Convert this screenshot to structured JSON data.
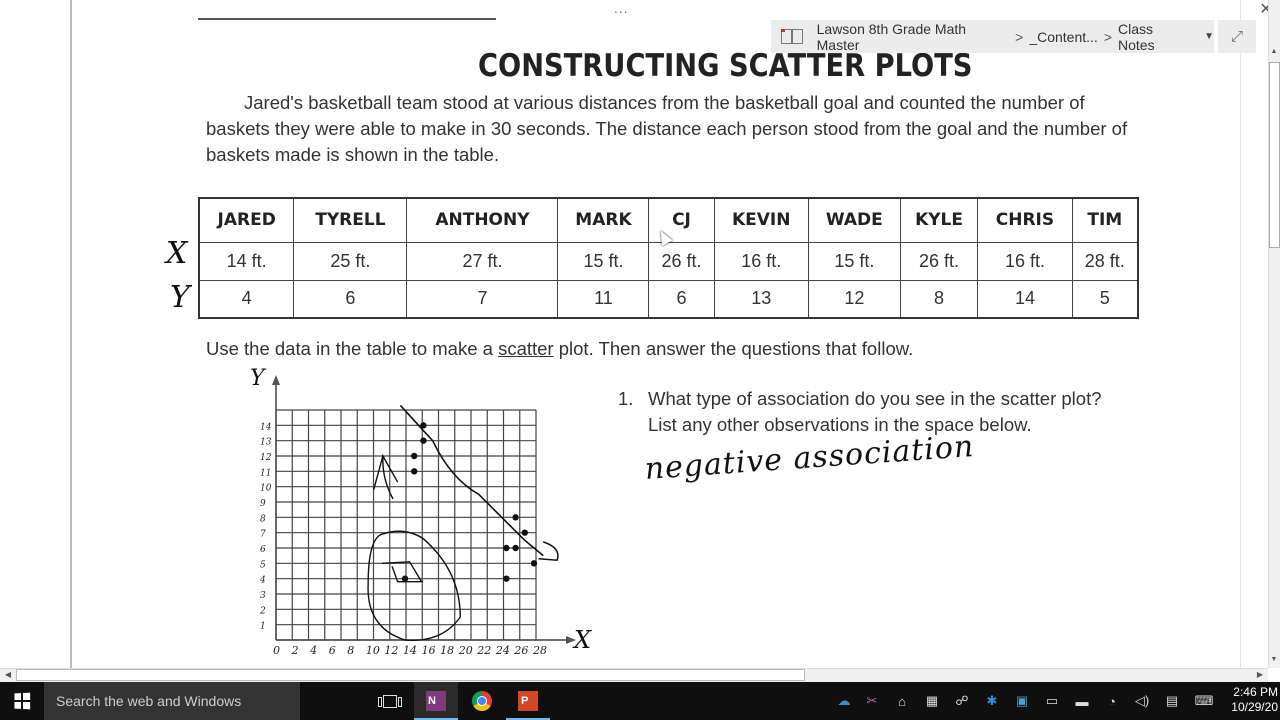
{
  "breadcrumb": {
    "notebook": "Lawson 8th Grade Math Master",
    "section": "_Content...",
    "page": "Class Notes",
    "separator": ">"
  },
  "window": {
    "more_label": "...",
    "close_glyph": "✕",
    "expand_glyph": "⤢",
    "caret_glyph": "▼"
  },
  "worksheet": {
    "title": "CONSTRUCTING SCATTER PLOTS",
    "intro": "Jared's basketball team stood at various distances from the basketball goal and counted the number of baskets they were able to make in 30 seconds. The distance each person stood from the goal and the number of baskets made is shown in the table.",
    "table": {
      "names": [
        "JARED",
        "TYRELL",
        "ANTHONY",
        "MARK",
        "CJ",
        "KEVIN",
        "WADE",
        "KYLE",
        "CHRIS",
        "TIM"
      ],
      "distances": [
        "14 ft.",
        "25 ft.",
        "27 ft.",
        "15 ft.",
        "26 ft.",
        "16 ft.",
        "15 ft.",
        "26 ft.",
        "16 ft.",
        "28 ft."
      ],
      "baskets": [
        "4",
        "6",
        "7",
        "11",
        "6",
        "13",
        "12",
        "8",
        "14",
        "5"
      ],
      "row_labels_handwritten": [
        "X",
        "Y"
      ]
    },
    "instruction_pre": "Use the data in the table to make a ",
    "instruction_ul": "scatter",
    "instruction_post": " plot. Then answer the questions that follow.",
    "question_number": "1.",
    "question_text": "What type of association do you see in the scatter plot? List any other observations in the space below.",
    "answer_handwritten": "negative association"
  },
  "chart_data": {
    "type": "scatter",
    "title": "",
    "xlabel": "X",
    "ylabel": "Y",
    "x_ticks": [
      "0",
      "2",
      "4",
      "6",
      "8",
      "10",
      "12",
      "14",
      "16",
      "18",
      "20",
      "22",
      "24",
      "26",
      "28"
    ],
    "y_ticks": [
      "1",
      "2",
      "3",
      "4",
      "5",
      "6",
      "7",
      "8",
      "9",
      "10",
      "11",
      "12",
      "13",
      "14"
    ],
    "xlim": [
      0,
      28
    ],
    "ylim": [
      0,
      14
    ],
    "grid": true,
    "points": [
      {
        "x": 14,
        "y": 4
      },
      {
        "x": 25,
        "y": 6
      },
      {
        "x": 27,
        "y": 7
      },
      {
        "x": 15,
        "y": 11
      },
      {
        "x": 26,
        "y": 6
      },
      {
        "x": 16,
        "y": 13
      },
      {
        "x": 15,
        "y": 12
      },
      {
        "x": 26,
        "y": 8
      },
      {
        "x": 16,
        "y": 14
      },
      {
        "x": 28,
        "y": 5
      },
      {
        "x": 25,
        "y": 4
      }
    ],
    "annotations": [
      "hand-drawn trend line (negative)",
      "circled outlier near (14, 4)"
    ]
  },
  "taskbar": {
    "search_placeholder": "Search the web and Windows",
    "apps": [
      {
        "name": "task-view"
      },
      {
        "name": "onenote",
        "label": "N"
      },
      {
        "name": "chrome"
      },
      {
        "name": "powerpoint",
        "label": "P"
      }
    ],
    "time": "2:46 PM",
    "date": "10/29/20"
  },
  "scroll": {
    "up": "▲",
    "down": "▼",
    "left": "◀",
    "right": "▶"
  }
}
